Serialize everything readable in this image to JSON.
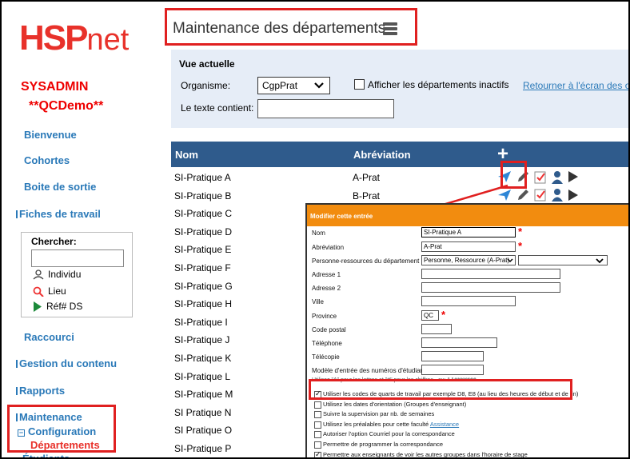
{
  "logo": {
    "left": "HSP",
    "right": "net"
  },
  "user": {
    "name": "SYSADMIN",
    "instance": "**QCDemo**"
  },
  "sidebar": {
    "links": [
      "Bienvenue",
      "Cohortes",
      "Boite de sortie"
    ],
    "fiches": "Fiches de travail",
    "search": {
      "label": "Chercher:",
      "options": [
        "Individu",
        "Lieu",
        "Réf# DS"
      ]
    },
    "raccourci": "Raccourci",
    "gestion": "Gestion du contenu",
    "rapports": "Rapports",
    "maintenance": "Maintenance",
    "configuration": "Configuration",
    "departements": "Départements",
    "etudiants": "Étudiants"
  },
  "page": {
    "title": "Maintenance des départements"
  },
  "filter": {
    "heading": "Vue actuelle",
    "org_label": "Organisme:",
    "org_value": "CgpPrat",
    "inactive_label": "Afficher les départements inactifs",
    "return_link": "Retourner à l'écran des or",
    "text_label": "Le texte contient:",
    "text_value": ""
  },
  "table": {
    "headers": {
      "name": "Nom",
      "abbr": "Abréviation",
      "add": "+"
    },
    "rows": [
      {
        "name": "SI-Pratique A",
        "abbr": "A-Prat"
      },
      {
        "name": "SI-Pratique B",
        "abbr": "B-Prat"
      },
      {
        "name": "SI-Pratique C",
        "abbr": ""
      },
      {
        "name": "SI-Pratique D",
        "abbr": ""
      },
      {
        "name": "SI-Pratique E",
        "abbr": ""
      },
      {
        "name": "SI-Pratique F",
        "abbr": ""
      },
      {
        "name": "SI-Pratique G",
        "abbr": ""
      },
      {
        "name": "SI-Pratique H",
        "abbr": ""
      },
      {
        "name": "SI-Pratique I",
        "abbr": ""
      },
      {
        "name": "SI-Pratique J",
        "abbr": ""
      },
      {
        "name": "SI-Pratique K",
        "abbr": ""
      },
      {
        "name": "SI-Pratique L",
        "abbr": ""
      },
      {
        "name": "SI-Pratique M",
        "abbr": ""
      },
      {
        "name": "SI Pratique N",
        "abbr": ""
      },
      {
        "name": "SI Pratique O",
        "abbr": ""
      },
      {
        "name": "SI-Pratique P",
        "abbr": ""
      }
    ]
  },
  "modal": {
    "title": "Modifier cette entrée",
    "fields": {
      "nom": {
        "label": "Nom",
        "value": "SI-Pratique A"
      },
      "abbr": {
        "label": "Abréviation",
        "value": "A-Prat"
      },
      "personne": {
        "label": "Personne-ressources du département",
        "value": "Personne, Ressource (A-Prat)"
      },
      "adresse1": {
        "label": "Adresse 1"
      },
      "adresse2": {
        "label": "Adresse 2"
      },
      "ville": {
        "label": "Ville"
      },
      "province": {
        "label": "Province",
        "value": "QC"
      },
      "postal": {
        "label": "Code postal"
      },
      "tel": {
        "label": "Téléphone"
      },
      "fax": {
        "label": "Télécopie"
      },
      "modele": {
        "label": "Modèle d'entrée des numéros d'étudiants"
      }
    },
    "hint": "Utilisez \"A\" pour les lettres et \"#\" pour les chiffres - ex: AA#######",
    "checks": [
      {
        "label": "Utiliser les codes de quarts de travail par exemple D8, E8 (au lieu des heures de début et de fin)",
        "checked": true
      },
      {
        "label": "Utilisez les dates d'orientation (Groupes d'enseignant)",
        "checked": false
      },
      {
        "label": "Suivre la supervision par nb. de semaines",
        "checked": false
      },
      {
        "label": "Utilisez les préalables pour cette faculté",
        "link": "Assistance",
        "checked": false
      },
      {
        "label": "Autoriser l'option Courriel pour la correspondance",
        "checked": false
      },
      {
        "label": "Permettre de programmer la correspondance",
        "checked": false
      },
      {
        "label": "Permettre aux enseignants de voir les autres groupes dans l'horaire de stage",
        "checked": true
      }
    ]
  },
  "colors": {
    "brand_red": "#e8312a",
    "link_blue": "#2a79b8",
    "header_blue": "#2f5b8c",
    "modal_orange": "#f28c0f",
    "highlight": "#e02020"
  }
}
